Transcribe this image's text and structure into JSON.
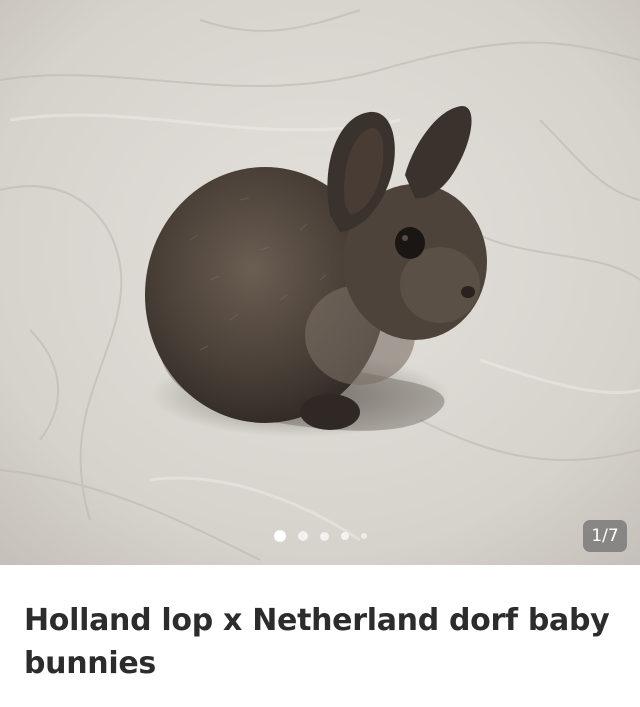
{
  "listing": {
    "title": "Holland lop x Netherland dorf baby bunnies",
    "photo_subject": "bunny",
    "gallery": {
      "counter": "1/7",
      "total_photos": 7,
      "current_photo": 1
    }
  },
  "colors": {
    "background": "#ffffff",
    "title_text": "#2c2c2c",
    "counter_badge": "#6e6e6e"
  }
}
